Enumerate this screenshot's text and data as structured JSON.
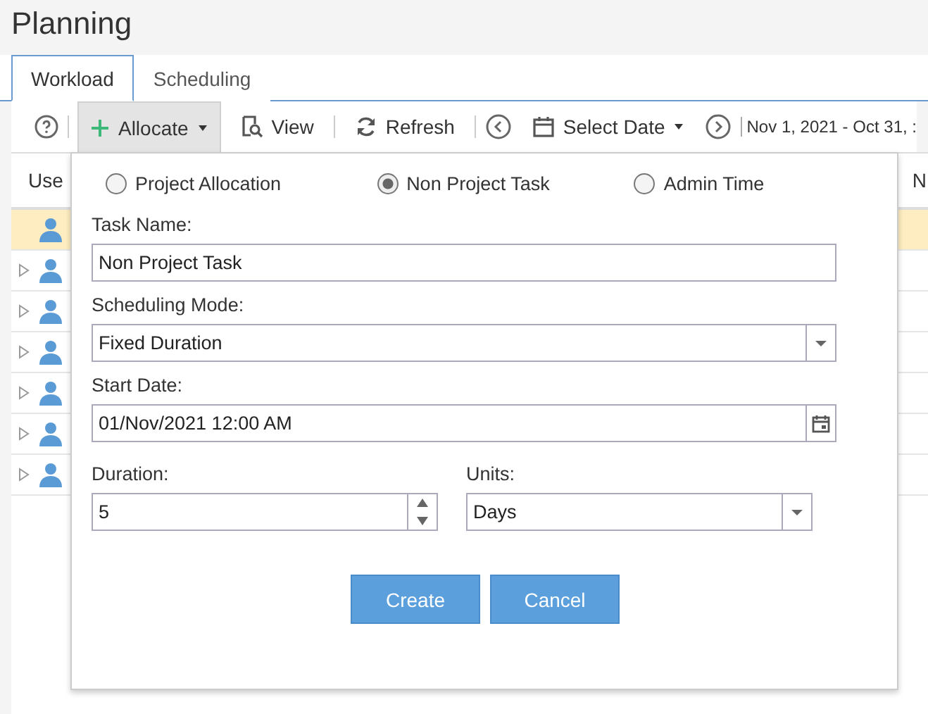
{
  "page": {
    "title": "Planning"
  },
  "tabs": [
    {
      "label": "Workload",
      "selected": true
    },
    {
      "label": "Scheduling",
      "selected": false
    }
  ],
  "toolbar": {
    "allocate": "Allocate",
    "view": "View",
    "refresh": "Refresh",
    "select_date": "Select Date",
    "date_range": "Nov 1, 2021 - Oct 31, :"
  },
  "table": {
    "columns": [
      "Use",
      "N"
    ],
    "rows": [
      {
        "selected": true,
        "expandable": false
      },
      {
        "selected": false,
        "expandable": true
      },
      {
        "selected": false,
        "expandable": true
      },
      {
        "selected": false,
        "expandable": true
      },
      {
        "selected": false,
        "expandable": true
      },
      {
        "selected": false,
        "expandable": true
      },
      {
        "selected": false,
        "expandable": true
      }
    ]
  },
  "popup": {
    "options": [
      {
        "label": "Project Allocation",
        "selected": false
      },
      {
        "label": "Non Project Task",
        "selected": true
      },
      {
        "label": "Admin Time",
        "selected": false
      }
    ],
    "task_name": {
      "label": "Task Name:",
      "value": "Non Project Task"
    },
    "scheduling_mode": {
      "label": "Scheduling Mode:",
      "value": "Fixed Duration"
    },
    "start_date": {
      "label": "Start Date:",
      "value": "01/Nov/2021 12:00 AM"
    },
    "duration": {
      "label": "Duration:",
      "value": "5"
    },
    "units": {
      "label": "Units:",
      "value": "Days"
    },
    "buttons": [
      "Create",
      "Cancel"
    ]
  }
}
